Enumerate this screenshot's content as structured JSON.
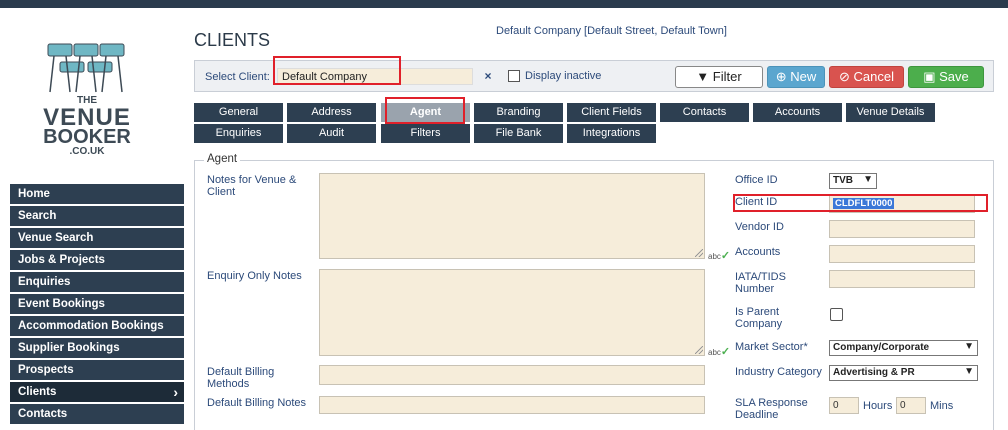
{
  "header": {
    "page_title": "CLIENTS",
    "company_info": "Default Company [Default Street, Default Town]"
  },
  "logo": {
    "line1": "THE",
    "line2": "VENUE",
    "line3": "BOOKER",
    "line4": ".CO.UK"
  },
  "sidebar": {
    "items": [
      {
        "label": "Home"
      },
      {
        "label": "Search"
      },
      {
        "label": "Venue Search"
      },
      {
        "label": "Jobs & Projects"
      },
      {
        "label": "Enquiries"
      },
      {
        "label": "Event Bookings"
      },
      {
        "label": "Accommodation Bookings"
      },
      {
        "label": "Supplier Bookings"
      },
      {
        "label": "Prospects"
      },
      {
        "label": "Clients"
      },
      {
        "label": "Contacts"
      }
    ],
    "active": "Clients"
  },
  "client_bar": {
    "select_label": "Select Client:",
    "client_value": "Default Company",
    "clear_icon": "×",
    "display_inactive_label": "Display inactive",
    "filter_label": "Filter",
    "new_label": "New",
    "cancel_label": "Cancel",
    "save_label": "Save"
  },
  "tabs": {
    "row1": [
      "General",
      "Address",
      "Agent",
      "Branding",
      "Client Fields",
      "Contacts",
      "Accounts",
      "Venue Details"
    ],
    "row2": [
      "Enquiries",
      "Audit",
      "Filters",
      "File Bank",
      "Integrations"
    ],
    "active": "Agent"
  },
  "agent": {
    "legend": "Agent",
    "notes_label": "Notes for Venue & Client",
    "enquiry_notes_label": "Enquiry Only Notes",
    "billing_methods_label": "Default Billing Methods",
    "billing_notes_label": "Default Billing Notes",
    "spell_text": "abc",
    "office_id_label": "Office ID",
    "office_id_value": "TVB",
    "client_id_label": "Client ID",
    "client_id_value": "CLDFLT0000",
    "vendor_id_label": "Vendor ID",
    "accounts_label": "Accounts",
    "iata_label": "IATA/TIDS Number",
    "is_parent_label": "Is Parent Company",
    "market_sector_label": "Market Sector*",
    "market_sector_value": "Company/Corporate",
    "industry_label": "Industry Category",
    "industry_value": "Advertising & PR",
    "sla_label": "SLA Response Deadline",
    "sla_hours_value": "0",
    "sla_hours_label": "Hours",
    "sla_mins_value": "0",
    "sla_mins_label": "Mins"
  },
  "colors": {
    "nav_dark": "#2d3f51",
    "field_bg": "#f6edda",
    "new_button": "#5ba6cf",
    "cancel_button": "#d9534f",
    "save_button": "#4cae4c",
    "highlight_box": "#e0202a"
  }
}
